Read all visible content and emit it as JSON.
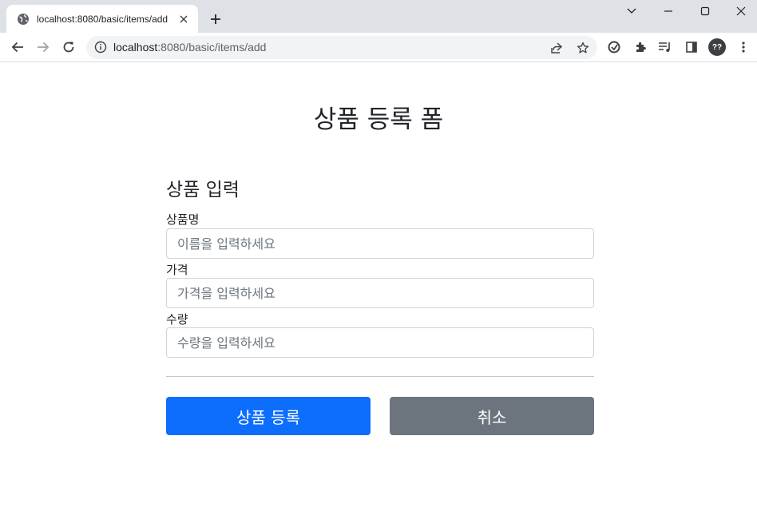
{
  "browser": {
    "tab_title": "localhost:8080/basic/items/add",
    "url_host": "localhost",
    "url_rest": ":8080/basic/items/add",
    "profile_initials": "??"
  },
  "page": {
    "title": "상품 등록 폼",
    "section_title": "상품 입력",
    "fields": [
      {
        "label": "상품명",
        "placeholder": "이름을 입력하세요",
        "value": ""
      },
      {
        "label": "가격",
        "placeholder": "가격을 입력하세요",
        "value": ""
      },
      {
        "label": "수량",
        "placeholder": "수량을 입력하세요",
        "value": ""
      }
    ],
    "submit_label": "상품 등록",
    "cancel_label": "취소"
  },
  "colors": {
    "primary": "#0d6efd",
    "secondary": "#6c757d",
    "tabstrip": "#dee1e6"
  }
}
